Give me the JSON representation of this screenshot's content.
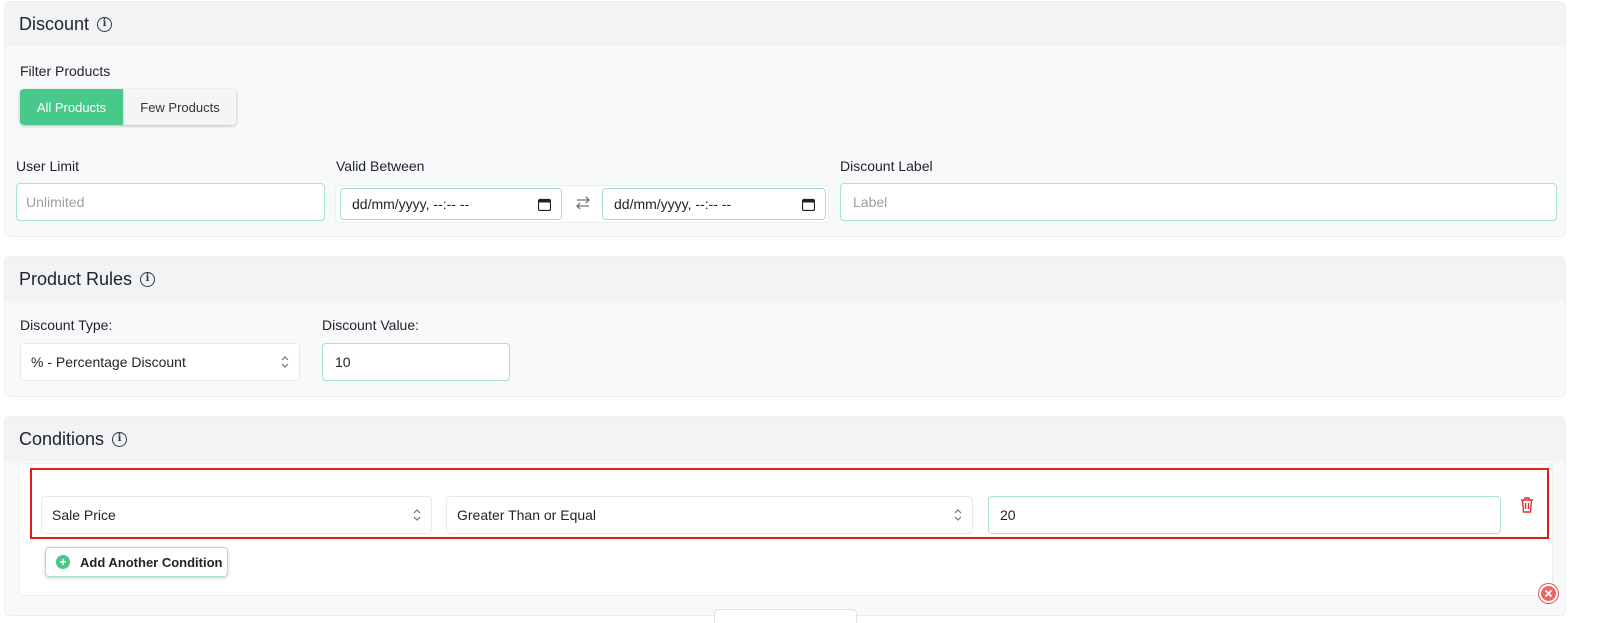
{
  "discount": {
    "title": "Discount",
    "filter_label": "Filter Products",
    "filter_options": [
      "All Products",
      "Few Products"
    ],
    "user_limit": {
      "label": "User Limit",
      "placeholder": "Unlimited"
    },
    "valid_between": {
      "label": "Valid Between",
      "start": "dd/mm/yyyy, --:-- --",
      "end": "dd/mm/yyyy, --:-- --"
    },
    "discount_label": {
      "label": "Discount Label",
      "placeholder": "Label"
    }
  },
  "product_rules": {
    "title": "Product Rules",
    "type_label": "Discount Type:",
    "type_value": "% - Percentage Discount",
    "value_label": "Discount Value:",
    "value": "10"
  },
  "conditions": {
    "title": "Conditions",
    "rows": [
      {
        "field": "Sale Price",
        "operator": "Greater Than or Equal",
        "value": "20"
      }
    ],
    "add_label": "Add Another Condition"
  },
  "colors": {
    "accent": "#48c98a",
    "field_border": "#a7e3c4",
    "danger": "#e21b1b"
  },
  "icons": [
    "info-icon",
    "calendar-icon",
    "swap-icon",
    "chevron-updown-icon",
    "plus-circle-icon",
    "trash-icon",
    "close-circle-icon"
  ]
}
